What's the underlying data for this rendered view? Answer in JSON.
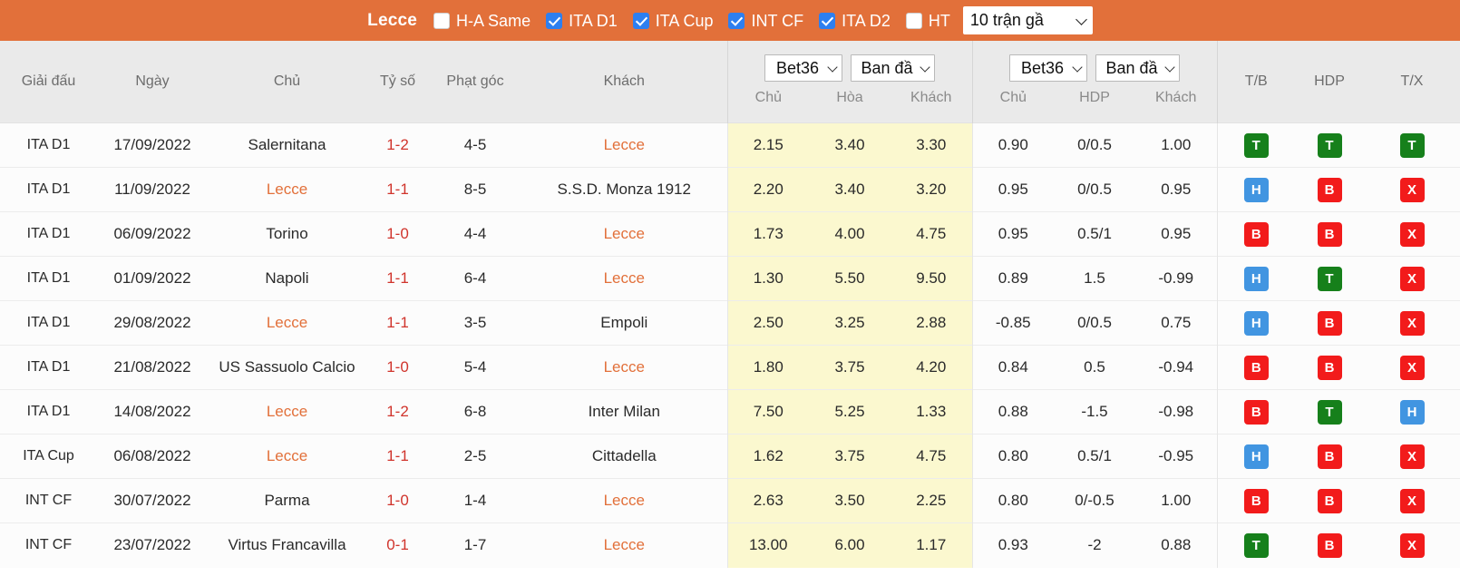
{
  "topbar": {
    "team": "Lecce",
    "filters": [
      {
        "label": "H-A Same",
        "checked": false
      },
      {
        "label": "ITA D1",
        "checked": true
      },
      {
        "label": "ITA Cup",
        "checked": true
      },
      {
        "label": "INT CF",
        "checked": true
      },
      {
        "label": "ITA D2",
        "checked": true
      },
      {
        "label": "HT",
        "checked": false
      }
    ],
    "match_count_select": "10 trận gầ",
    "accent_color": "#e2703a",
    "checkbox_color": "#2d7ff0"
  },
  "table": {
    "headers": {
      "league": "Giải đấu",
      "date": "Ngày",
      "home": "Chủ",
      "score": "Tỷ số",
      "corner": "Phạt góc",
      "away": "Khách",
      "tb": "T/B",
      "hdp": "HDP",
      "tx": "T/X"
    },
    "groups": [
      {
        "name": "1x2-odds",
        "bookmaker": "Bet36",
        "odds_type": "Ban đầ",
        "subheaders": [
          "Chủ",
          "Hòa",
          "Khách"
        ]
      },
      {
        "name": "asian-handicap-odds",
        "bookmaker": "Bet36",
        "odds_type": "Ban đầ",
        "subheaders": [
          "Chủ",
          "HDP",
          "Khách"
        ]
      }
    ],
    "rows": [
      {
        "league": "ITA D1",
        "date": "17/09/2022",
        "home": "Salernitana",
        "home_hl": false,
        "score": "1-2",
        "corner": "4-5",
        "away": "Lecce",
        "away_hl": true,
        "o1": "2.15",
        "ox": "3.40",
        "o2": "3.30",
        "ah_home": "0.90",
        "ah_hdp": "0/0.5",
        "ah_away": "1.00",
        "tb": "T",
        "hdp": "T",
        "tx": "T"
      },
      {
        "league": "ITA D1",
        "date": "11/09/2022",
        "home": "Lecce",
        "home_hl": true,
        "score": "1-1",
        "corner": "8-5",
        "away": "S.S.D. Monza 1912",
        "away_hl": false,
        "o1": "2.20",
        "ox": "3.40",
        "o2": "3.20",
        "ah_home": "0.95",
        "ah_hdp": "0/0.5",
        "ah_away": "0.95",
        "tb": "H",
        "hdp": "B",
        "tx": "X"
      },
      {
        "league": "ITA D1",
        "date": "06/09/2022",
        "home": "Torino",
        "home_hl": false,
        "score": "1-0",
        "corner": "4-4",
        "away": "Lecce",
        "away_hl": true,
        "o1": "1.73",
        "ox": "4.00",
        "o2": "4.75",
        "ah_home": "0.95",
        "ah_hdp": "0.5/1",
        "ah_away": "0.95",
        "tb": "B",
        "hdp": "B",
        "tx": "X"
      },
      {
        "league": "ITA D1",
        "date": "01/09/2022",
        "home": "Napoli",
        "home_hl": false,
        "score": "1-1",
        "corner": "6-4",
        "away": "Lecce",
        "away_hl": true,
        "o1": "1.30",
        "ox": "5.50",
        "o2": "9.50",
        "ah_home": "0.89",
        "ah_hdp": "1.5",
        "ah_away": "-0.99",
        "tb": "H",
        "hdp": "T",
        "tx": "X"
      },
      {
        "league": "ITA D1",
        "date": "29/08/2022",
        "home": "Lecce",
        "home_hl": true,
        "score": "1-1",
        "corner": "3-5",
        "away": "Empoli",
        "away_hl": false,
        "o1": "2.50",
        "ox": "3.25",
        "o2": "2.88",
        "ah_home": "-0.85",
        "ah_hdp": "0/0.5",
        "ah_away": "0.75",
        "tb": "H",
        "hdp": "B",
        "tx": "X"
      },
      {
        "league": "ITA D1",
        "date": "21/08/2022",
        "home": "US Sassuolo Calcio",
        "home_hl": false,
        "score": "1-0",
        "corner": "5-4",
        "away": "Lecce",
        "away_hl": true,
        "o1": "1.80",
        "ox": "3.75",
        "o2": "4.20",
        "ah_home": "0.84",
        "ah_hdp": "0.5",
        "ah_away": "-0.94",
        "tb": "B",
        "hdp": "B",
        "tx": "X"
      },
      {
        "league": "ITA D1",
        "date": "14/08/2022",
        "home": "Lecce",
        "home_hl": true,
        "score": "1-2",
        "corner": "6-8",
        "away": "Inter Milan",
        "away_hl": false,
        "o1": "7.50",
        "ox": "5.25",
        "o2": "1.33",
        "ah_home": "0.88",
        "ah_hdp": "-1.5",
        "ah_away": "-0.98",
        "tb": "B",
        "hdp": "T",
        "tx": "H"
      },
      {
        "league": "ITA Cup",
        "date": "06/08/2022",
        "home": "Lecce",
        "home_hl": true,
        "score": "1-1",
        "corner": "2-5",
        "away": "Cittadella",
        "away_hl": false,
        "o1": "1.62",
        "ox": "3.75",
        "o2": "4.75",
        "ah_home": "0.80",
        "ah_hdp": "0.5/1",
        "ah_away": "-0.95",
        "tb": "H",
        "hdp": "B",
        "tx": "X"
      },
      {
        "league": "INT CF",
        "date": "30/07/2022",
        "home": "Parma",
        "home_hl": false,
        "score": "1-0",
        "corner": "1-4",
        "away": "Lecce",
        "away_hl": true,
        "o1": "2.63",
        "ox": "3.50",
        "o2": "2.25",
        "ah_home": "0.80",
        "ah_hdp": "0/-0.5",
        "ah_away": "1.00",
        "tb": "B",
        "hdp": "B",
        "tx": "X"
      },
      {
        "league": "INT CF",
        "date": "23/07/2022",
        "home": "Virtus Francavilla",
        "home_hl": false,
        "score": "0-1",
        "corner": "1-7",
        "away": "Lecce",
        "away_hl": true,
        "o1": "13.00",
        "ox": "6.00",
        "o2": "1.17",
        "ah_home": "0.93",
        "ah_hdp": "-2",
        "ah_away": "0.88",
        "tb": "T",
        "hdp": "B",
        "tx": "X"
      }
    ]
  }
}
